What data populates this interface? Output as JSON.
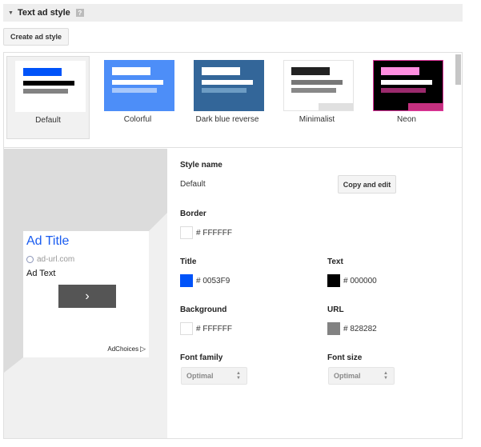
{
  "header": {
    "title": "Text ad style",
    "help_icon": "?"
  },
  "toolbar": {
    "create_label": "Create ad style"
  },
  "styles": [
    {
      "name": "Default",
      "selected": true,
      "bg": "#ffffff",
      "border": "#ffffff",
      "bars": [
        "#0053f9",
        "#000000",
        "#828282"
      ],
      "corner": null
    },
    {
      "name": "Colorful",
      "selected": false,
      "bg": "#4d8ef8",
      "border": "#4d8ef8",
      "bars": [
        "#ffffff",
        "#ffffff",
        "#a8c8fb"
      ],
      "corner": null
    },
    {
      "name": "Dark blue reverse",
      "selected": false,
      "bg": "#336699",
      "border": "#336699",
      "bars": [
        "#ffffff",
        "#ffffff",
        "#6d9cc4"
      ],
      "corner": null
    },
    {
      "name": "Minimalist",
      "selected": false,
      "bg": "#ffffff",
      "border": "#e4e4e4",
      "bars": [
        "#222222",
        "#777777",
        "#888888"
      ],
      "corner": "#e0e0e0"
    },
    {
      "name": "Neon",
      "selected": false,
      "bg": "#000000",
      "border": "#e0339b",
      "bars": [
        "#ff8ee0",
        "#ffffff",
        "#9b2a6d"
      ],
      "corner": "#c4307f"
    }
  ],
  "preview": {
    "title": "Ad Title",
    "url": "ad-url.com",
    "text": "Ad Text",
    "button_icon": "›",
    "adchoices": "AdChoices",
    "adchoices_icon": "▷"
  },
  "settings": {
    "style_name_label": "Style name",
    "style_name_value": "Default",
    "copy_edit_label": "Copy and edit",
    "border": {
      "label": "Border",
      "hex": "# FFFFFF",
      "color": "#ffffff"
    },
    "title": {
      "label": "Title",
      "hex": "# 0053F9",
      "color": "#0053f9"
    },
    "text": {
      "label": "Text",
      "hex": "# 000000",
      "color": "#000000"
    },
    "background": {
      "label": "Background",
      "hex": "# FFFFFF",
      "color": "#ffffff"
    },
    "url": {
      "label": "URL",
      "hex": "# 828282",
      "color": "#828282"
    },
    "font_family": {
      "label": "Font family",
      "value": "Optimal"
    },
    "font_size": {
      "label": "Font size",
      "value": "Optimal"
    }
  }
}
